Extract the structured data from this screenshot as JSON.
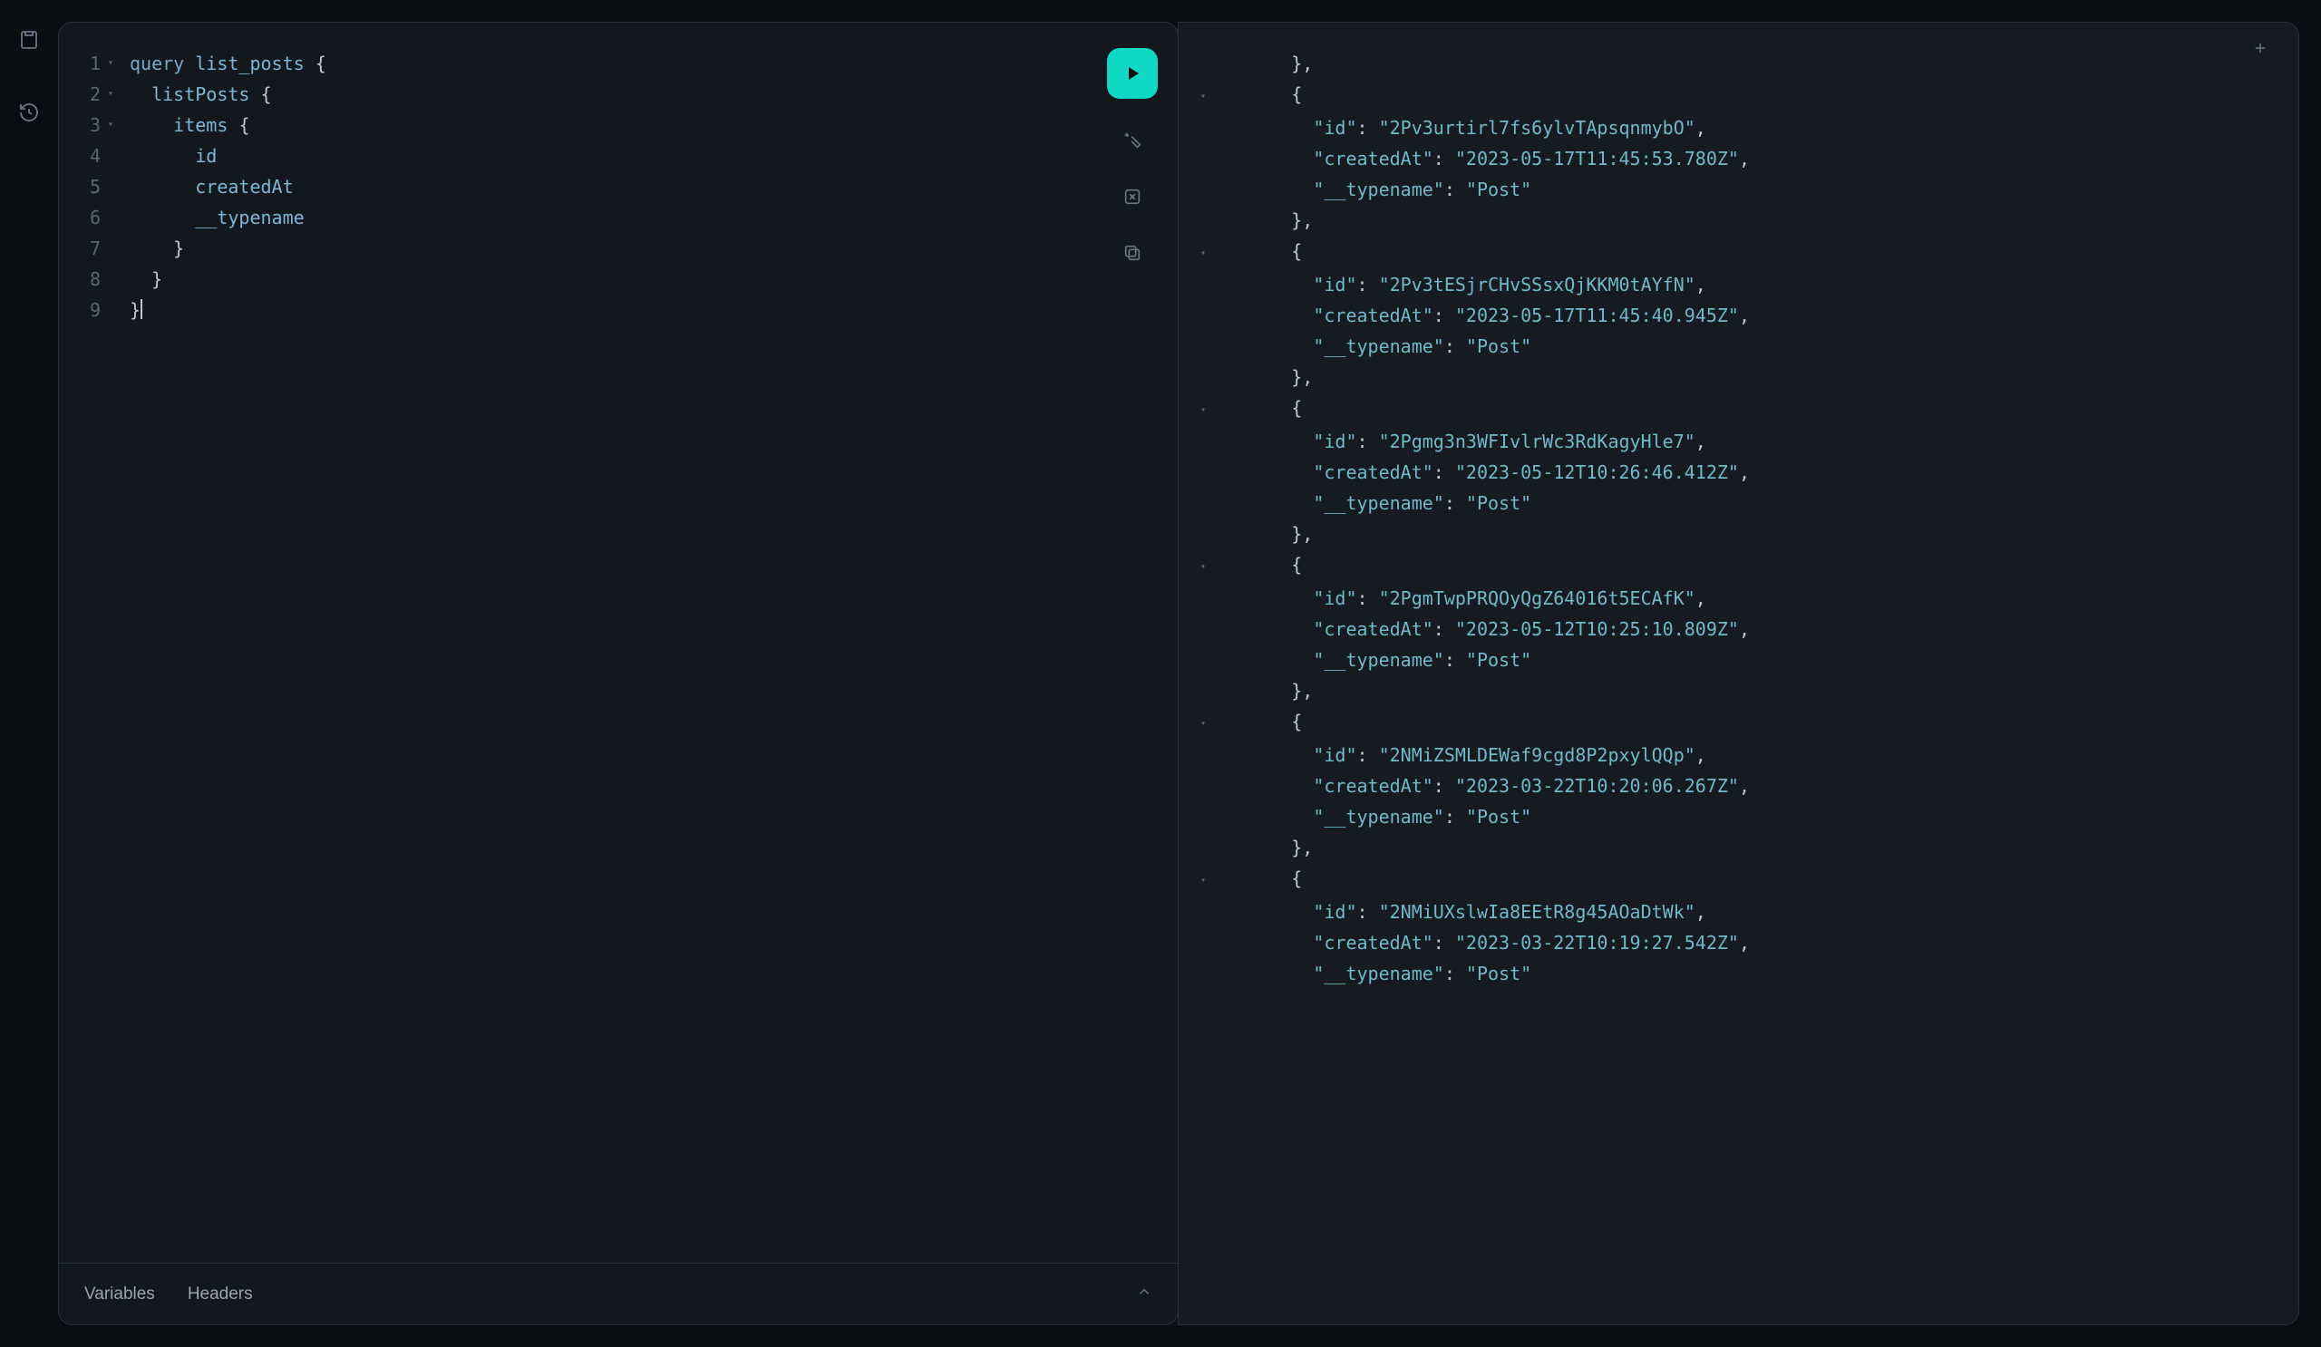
{
  "sidebar": {
    "docs_icon": "docs-icon",
    "history_icon": "history-icon"
  },
  "editor": {
    "lines": [
      {
        "n": 1,
        "fold": true,
        "html": "<span class='kw'>query</span> <span class='fn'>list_posts</span> <span class='pn'>{</span>"
      },
      {
        "n": 2,
        "fold": true,
        "html": "  <span class='fn'>listPosts</span> <span class='pn'>{</span>"
      },
      {
        "n": 3,
        "fold": true,
        "html": "    <span class='fn'>items</span> <span class='pn'>{</span>"
      },
      {
        "n": 4,
        "fold": false,
        "html": "      <span class='fn'>id</span>"
      },
      {
        "n": 5,
        "fold": false,
        "html": "      <span class='fn'>createdAt</span>"
      },
      {
        "n": 6,
        "fold": false,
        "html": "      <span class='fn'>__typename</span>"
      },
      {
        "n": 7,
        "fold": false,
        "html": "    <span class='pn'>}</span>"
      },
      {
        "n": 8,
        "fold": false,
        "html": "  <span class='pn'>}</span>"
      },
      {
        "n": 9,
        "fold": false,
        "html": "<span class='pn'>}</span><span class='cursor'></span>"
      }
    ],
    "query_text": "query list_posts {\n  listPosts {\n    items {\n      id\n      createdAt\n      __typename\n    }\n  }\n}"
  },
  "actions": {
    "run": "Run query",
    "prettify": "Prettify",
    "merge": "Merge fragments",
    "copy": "Copy"
  },
  "bottomTabs": {
    "variables": "Variables",
    "headers": "Headers"
  },
  "response": {
    "items": [
      {
        "id": "2Pv3urtirl7fs6ylvTApsqnmybO",
        "createdAt": "2023-05-17T11:45:53.780Z",
        "__typename": "Post"
      },
      {
        "id": "2Pv3tESjrCHvSSsxQjKKM0tAYfN",
        "createdAt": "2023-05-17T11:45:40.945Z",
        "__typename": "Post"
      },
      {
        "id": "2Pgmg3n3WFIvlrWc3RdKagyHle7",
        "createdAt": "2023-05-12T10:26:46.412Z",
        "__typename": "Post"
      },
      {
        "id": "2PgmTwpPRQOyQgZ64016t5ECAfK",
        "createdAt": "2023-05-12T10:25:10.809Z",
        "__typename": "Post"
      },
      {
        "id": "2NMiZSMLDEWaf9cgd8P2pxylQQp",
        "createdAt": "2023-03-22T10:20:06.267Z",
        "__typename": "Post"
      },
      {
        "id": "2NMiUXslwIa8EEtR8g45AOaDtWk",
        "createdAt": "2023-03-22T10:19:27.542Z",
        "__typename": "Post"
      }
    ],
    "truncated_trailing_key": "__typename",
    "truncated_trailing_value": "Post"
  }
}
